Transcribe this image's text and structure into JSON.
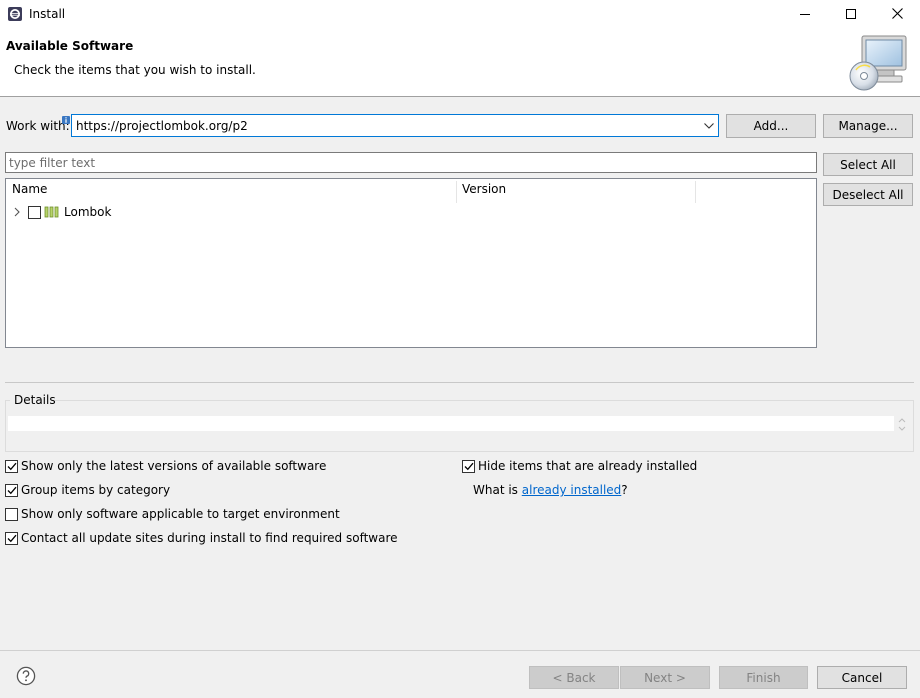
{
  "window": {
    "title": "Install",
    "icons": {
      "app": "eclipse-icon",
      "minimize": "minimize-icon",
      "maximize": "maximize-icon",
      "close": "close-icon"
    }
  },
  "header": {
    "title": "Available Software",
    "description": "Check the items that you wish to install.",
    "banner_icon": "install-software-banner-icon"
  },
  "work_with": {
    "label": "Work with:",
    "value": "https://projectlombok.org/p2",
    "add_label": "Add...",
    "manage_label": "Manage..."
  },
  "filter": {
    "placeholder": "type filter text"
  },
  "selection": {
    "select_all_label": "Select All",
    "deselect_all_label": "Deselect All"
  },
  "tree": {
    "columns": [
      "Name",
      "Version"
    ],
    "rows": [
      {
        "label": "Lombok",
        "checked": false,
        "expanded": false,
        "icon": "category-icon"
      }
    ]
  },
  "details": {
    "label": "Details"
  },
  "options": {
    "show_latest": {
      "label": "Show only the latest versions of available software",
      "checked": true
    },
    "group_by_category": {
      "label": "Group items by category",
      "checked": true
    },
    "show_applicable": {
      "label": "Show only software applicable to target environment",
      "checked": false
    },
    "contact_all_sites": {
      "label": "Contact all update sites during install to find required software",
      "checked": true
    },
    "hide_installed": {
      "label": "Hide items that are already installed",
      "checked": true
    },
    "what_is_prefix": "What is ",
    "already_installed_link": "already installed",
    "what_is_suffix": "?"
  },
  "footer": {
    "back_label": "< Back",
    "next_label": "Next >",
    "finish_label": "Finish",
    "cancel_label": "Cancel",
    "help_icon": "help-icon"
  },
  "colors": {
    "focus_border": "#0078d7",
    "link": "#0066cc",
    "dialog_bg": "#f0f0f0"
  }
}
